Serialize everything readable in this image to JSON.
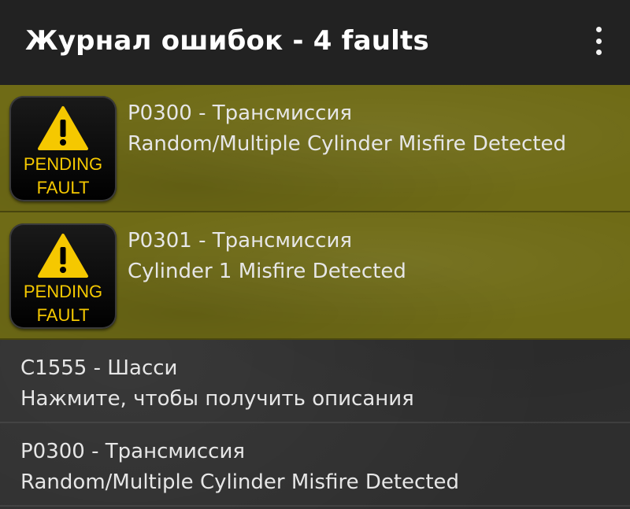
{
  "toolbar": {
    "title": "Журнал ошибок - 4 faults",
    "menu_icon": "more-vert-icon"
  },
  "badge": {
    "line1": "PENDING",
    "line2": "FAULT",
    "icon": "warning-triangle-icon",
    "text_color": "#f5c800"
  },
  "colors": {
    "pending_row": "#6f6b16",
    "toolbar": "#222222",
    "text": "#e6e6e6"
  },
  "faults": [
    {
      "code_line": "P0300 - Трансмиссия",
      "description": "Random/Multiple Cylinder Misfire Detected",
      "pending": true
    },
    {
      "code_line": "P0301 - Трансмиссия",
      "description": "Cylinder 1 Misfire Detected",
      "pending": true
    },
    {
      "code_line": "C1555 - Шасси",
      "description": "Нажмите, чтобы получить описания",
      "pending": false
    },
    {
      "code_line": "P0300 - Трансмиссия",
      "description": "Random/Multiple Cylinder Misfire Detected",
      "pending": false
    }
  ]
}
